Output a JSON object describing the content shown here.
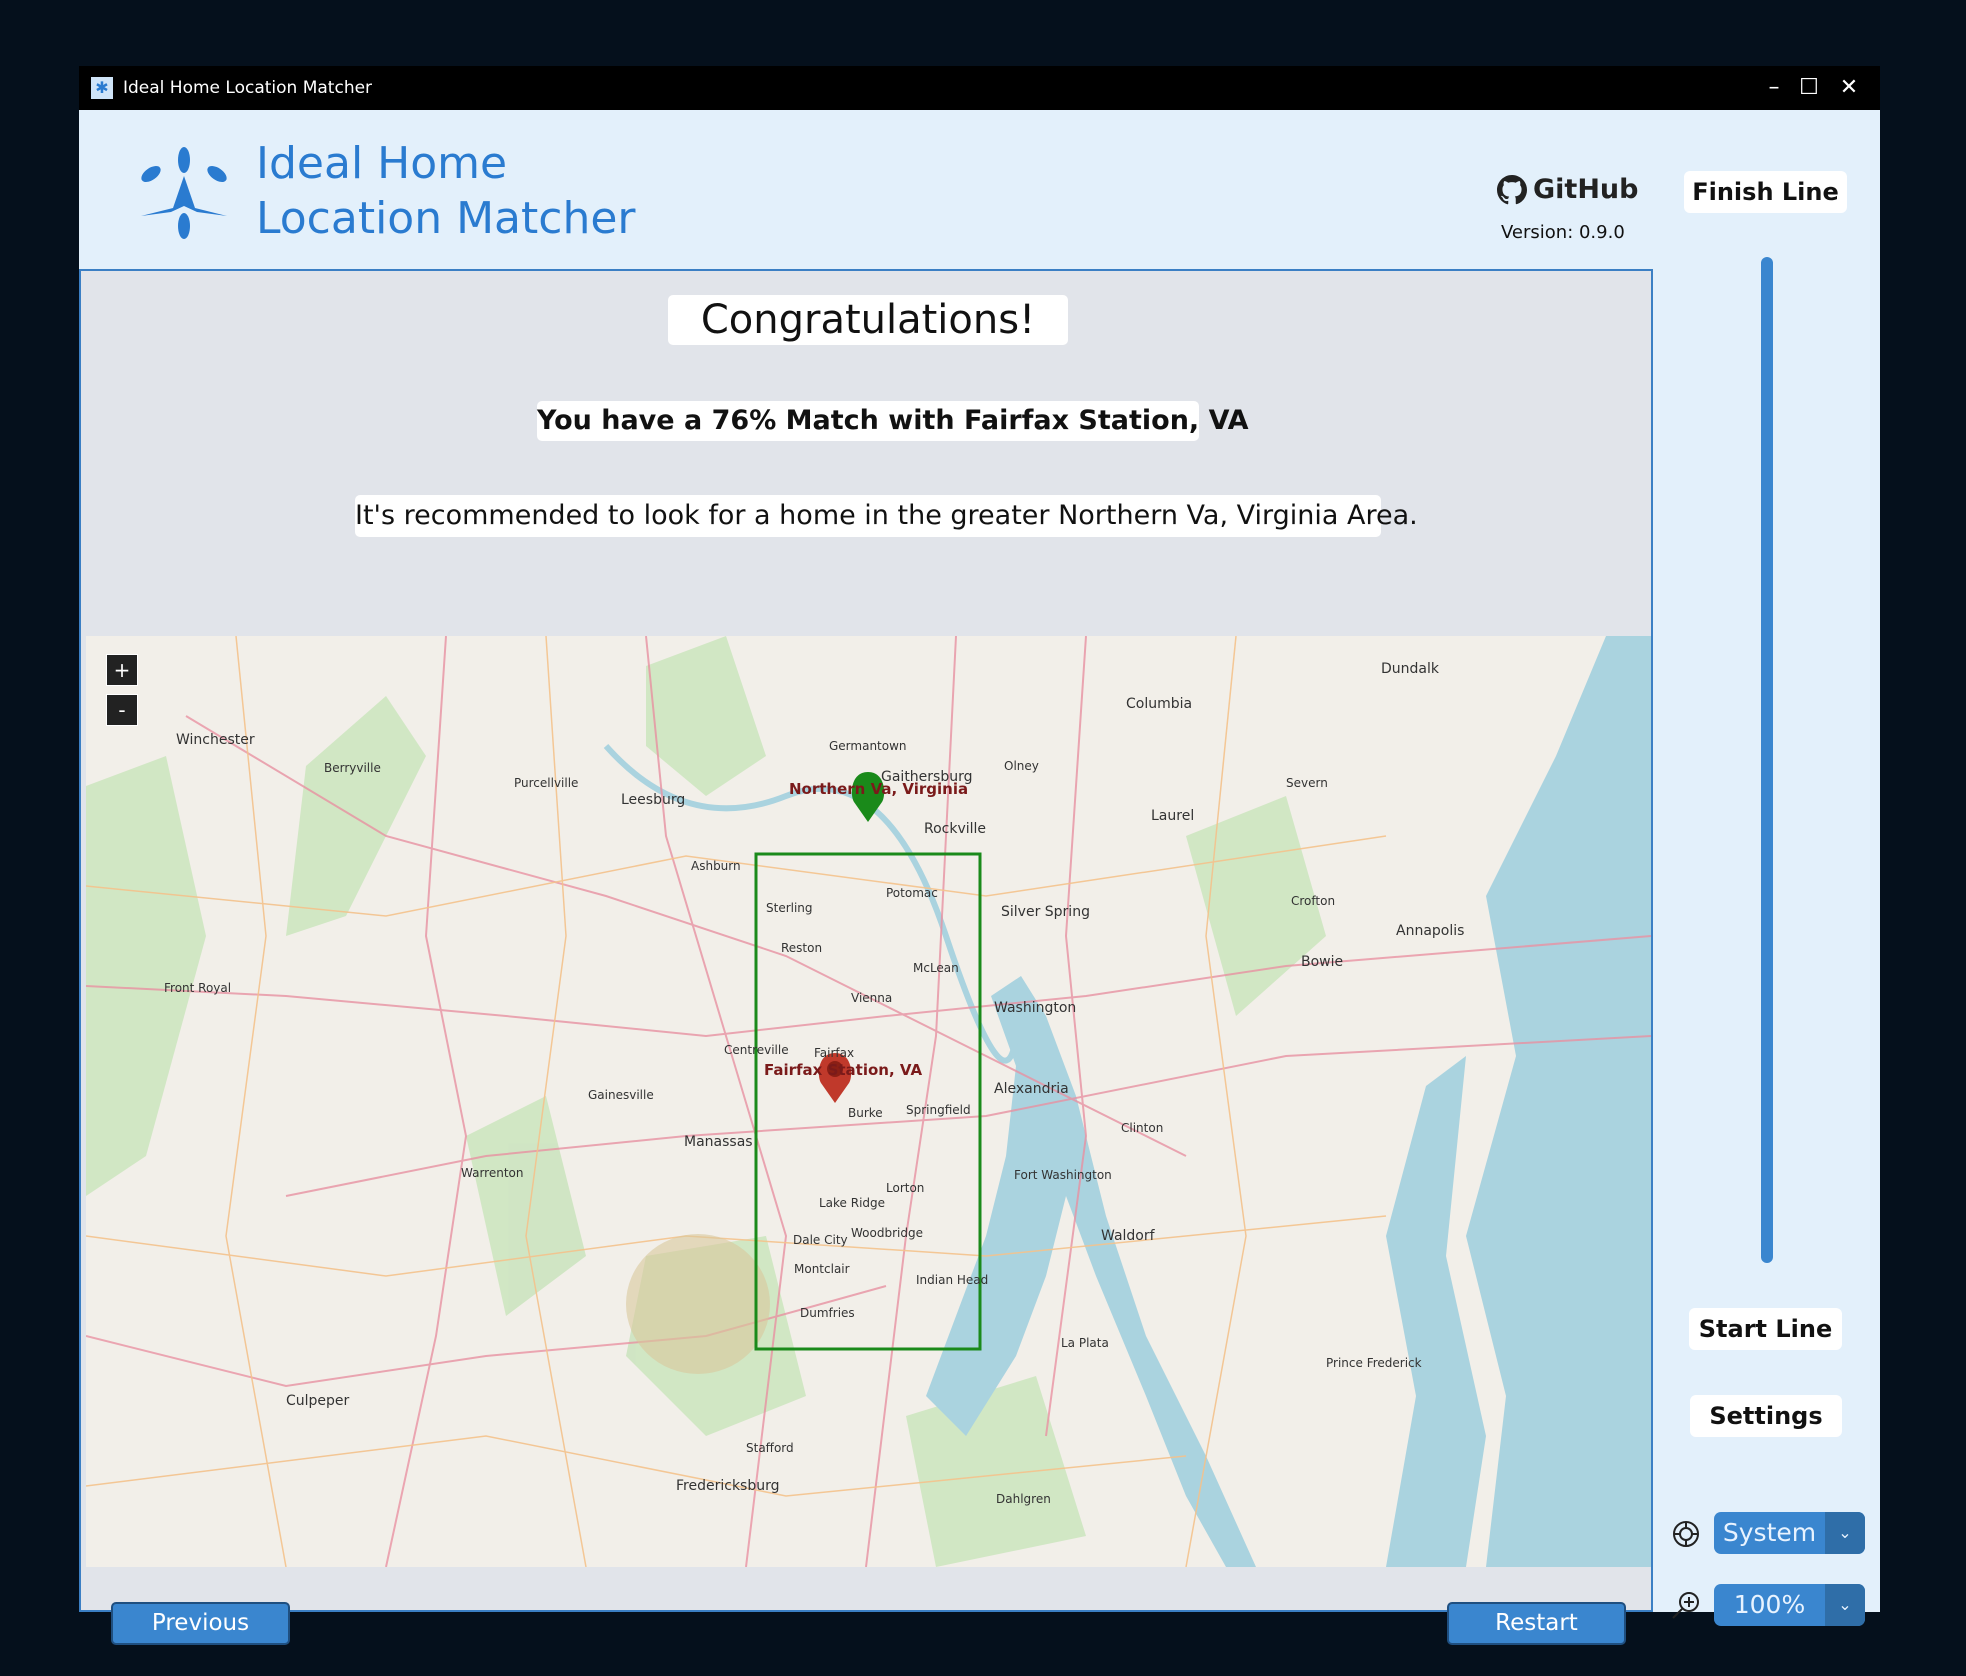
{
  "window": {
    "title": "Ideal Home Location Matcher",
    "minimize": "–",
    "maximize": "☐",
    "close": "✕"
  },
  "header": {
    "title_line1": "Ideal Home",
    "title_line2": "Location Matcher",
    "github_label": "GitHub",
    "version": "Version: 0.9.0"
  },
  "main": {
    "congrats": "Congratulations!",
    "match_text": "You have a 76% Match with Fairfax Station, VA",
    "recommendation": "It's recommended to look for a home in the greater Northern Va, Virginia Area."
  },
  "map": {
    "zoom_in": "+",
    "zoom_out": "-",
    "area_label": "Northern Va, Virginia",
    "match_label": "Fairfax Station, VA",
    "places": [
      "Winchester",
      "Leesburg",
      "Gaithersburg",
      "Rockville",
      "Columbia",
      "Dundalk",
      "Laurel",
      "Silver Spring",
      "Washington",
      "Alexandria",
      "Annapolis",
      "Bowie",
      "Manassas",
      "Fairfax",
      "Reston",
      "Vienna",
      "McLean",
      "Potomac",
      "Springfield",
      "Burke",
      "Lorton",
      "Woodbridge",
      "Dale City",
      "Dumfries",
      "Waldorf",
      "Culpeper",
      "Stafford",
      "Fredericksburg",
      "Warrenton",
      "Front Royal",
      "Berryville",
      "Purcellville",
      "Ashburn",
      "Sterling",
      "Centreville",
      "Lake Ridge",
      "Montclair",
      "Indian Head",
      "La Plata",
      "Clinton",
      "Fort Washington",
      "Gainesville",
      "Olney",
      "Germantown",
      "Severn",
      "Crofton",
      "Prince Frederick",
      "Dahlgren"
    ],
    "colors": {
      "bounds": "#1a8a1a",
      "area_pin": "#1a8a1a",
      "match_pin": "#c0392b"
    }
  },
  "buttons": {
    "previous": "Previous",
    "restart": "Restart"
  },
  "sidebar": {
    "finish_line": "Finish Line",
    "start_line": "Start Line",
    "settings": "Settings",
    "theme_value": "System",
    "zoom_value": "100%",
    "progress": 1.0
  },
  "colors": {
    "accent": "#3a86cf",
    "title_blue": "#2a7bd0",
    "panel_bg": "#e3f0fb"
  }
}
